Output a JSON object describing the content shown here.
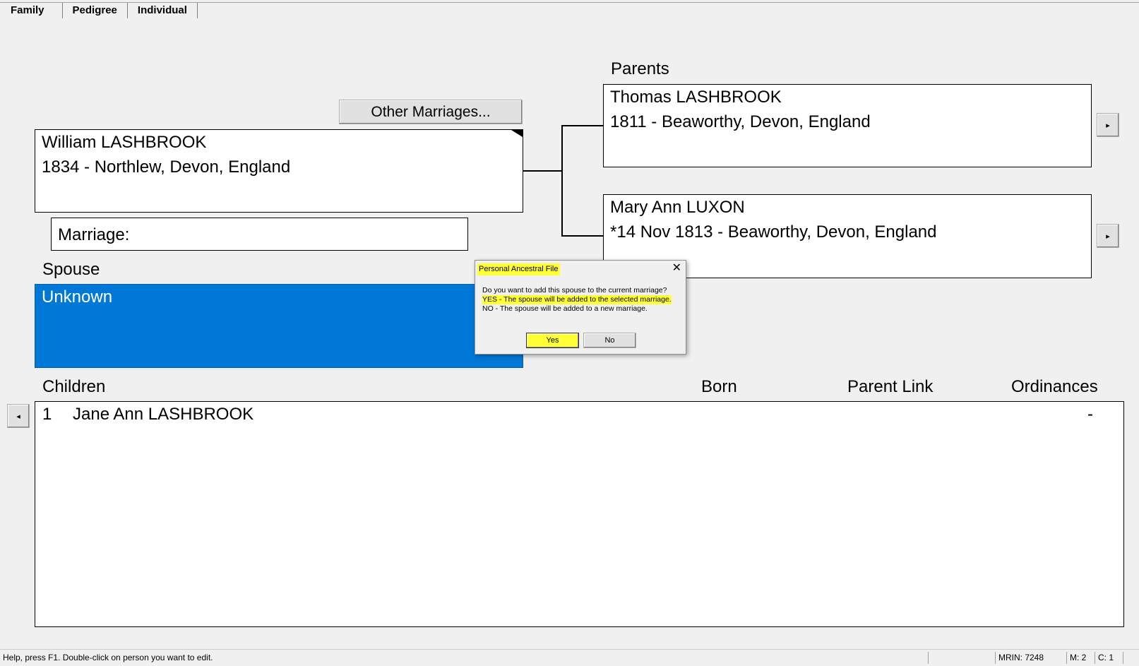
{
  "tabs": [
    "Family",
    "Pedigree",
    "Individual"
  ],
  "other_marriages_button": "Other Marriages...",
  "individual": {
    "name": "William LASHBROOK",
    "detail": "1834 - Northlew, Devon, England"
  },
  "marriage_label": "Marriage:",
  "spouse": {
    "label": "Spouse",
    "name": "Unknown"
  },
  "parents": {
    "label": "Parents",
    "father": {
      "name": "Thomas LASHBROOK",
      "detail": "1811 - Beaworthy, Devon, England"
    },
    "mother": {
      "name": "Mary Ann LUXON",
      "detail": "*14 Nov 1813 - Beaworthy, Devon, England"
    }
  },
  "dialog": {
    "title": "Personal Ancestral File",
    "question": "Do you want to add this spouse to the current marriage?",
    "yes_text": "YES - The spouse will be added to the selected marriage.",
    "no_text": "NO - The spouse will be added to a new marriage.",
    "yes_button": "Yes",
    "no_button": "No"
  },
  "children": {
    "headers": {
      "children": "Children",
      "born": "Born",
      "parent_link": "Parent Link",
      "ordinances": "Ordinances"
    },
    "rows": [
      {
        "num": "1",
        "name": "Jane Ann LASHBROOK",
        "born": "",
        "parent_link": "",
        "ordinances": "-"
      }
    ]
  },
  "status": {
    "help": "Help, press F1. Double-click on person you want to edit.",
    "mrin": "MRIN: 7248",
    "m": "M: 2",
    "c": "C: 1"
  },
  "colors": {
    "spouse_bg": "#0078d7",
    "highlight": "#ffff33"
  }
}
